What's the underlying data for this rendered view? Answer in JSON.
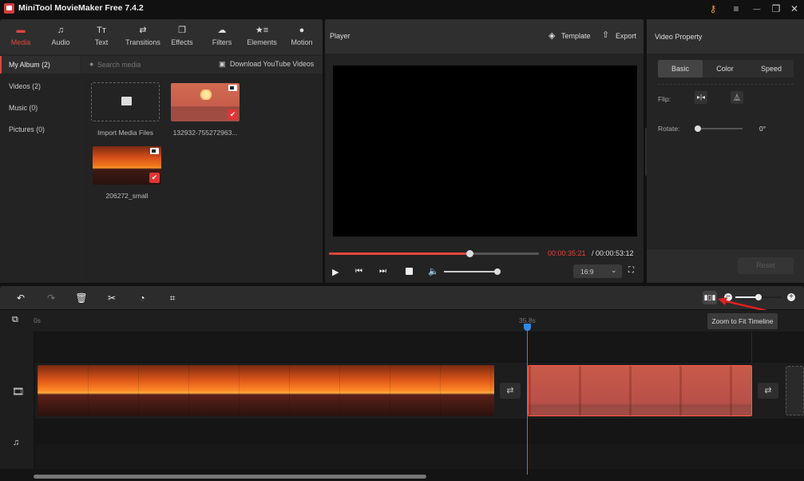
{
  "app": {
    "title": "MiniTool MovieMaker Free 7.4.2"
  },
  "window_controls": [
    {
      "name": "key-icon",
      "glyph": "⚷"
    },
    {
      "name": "menu-icon",
      "glyph": "≡"
    },
    {
      "name": "minimize-icon",
      "glyph": "—"
    },
    {
      "name": "restore-icon",
      "glyph": "❐"
    },
    {
      "name": "close-icon",
      "glyph": "✕"
    }
  ],
  "tabs": [
    {
      "label": "Media",
      "icon": "▬",
      "active": true
    },
    {
      "label": "Audio",
      "icon": "♫"
    },
    {
      "label": "Text",
      "icon": "Tт"
    },
    {
      "label": "Transitions",
      "icon": "⇄"
    },
    {
      "label": "Effects",
      "icon": "❐"
    },
    {
      "label": "Filters",
      "icon": "☁"
    },
    {
      "label": "Elements",
      "icon": "★≡"
    },
    {
      "label": "Motion",
      "icon": "●"
    }
  ],
  "album_sidebar": [
    {
      "label": "My Album (2)",
      "active": true
    },
    {
      "label": "Videos (2)"
    },
    {
      "label": "Music (0)"
    },
    {
      "label": "Pictures (0)"
    }
  ],
  "search": {
    "placeholder": "Search media",
    "download_label": "Download YouTube Videos"
  },
  "media": {
    "import_label": "Import Media Files",
    "items": [
      {
        "name": "132932-755272963...",
        "type": "video",
        "selected": true
      },
      {
        "name": "206272_small",
        "type": "video",
        "selected": true
      }
    ]
  },
  "player": {
    "title": "Player",
    "template_label": "Template",
    "export_label": "Export",
    "current_time": "00:00:35:21",
    "total_time": "/ 00:00:53:12",
    "progress": 0.67,
    "volume": 1.0,
    "aspect_ratio": "16:9"
  },
  "property": {
    "title": "Video Property",
    "tabs": [
      "Basic",
      "Color",
      "Speed"
    ],
    "active_tab": "Basic",
    "flip_label": "Flip:",
    "rotate_label": "Rotate:",
    "rotate_value": "0°",
    "reset_label": "Reset"
  },
  "timeline": {
    "ruler_start": "0s",
    "playhead_label": "35.8s",
    "tooltip": "Zoom to Fit Timeline",
    "zoom_level": 0.5
  },
  "colors": {
    "accent": "#e2453c",
    "playhead": "#2f8ae5",
    "time_current": "#e2453c"
  }
}
